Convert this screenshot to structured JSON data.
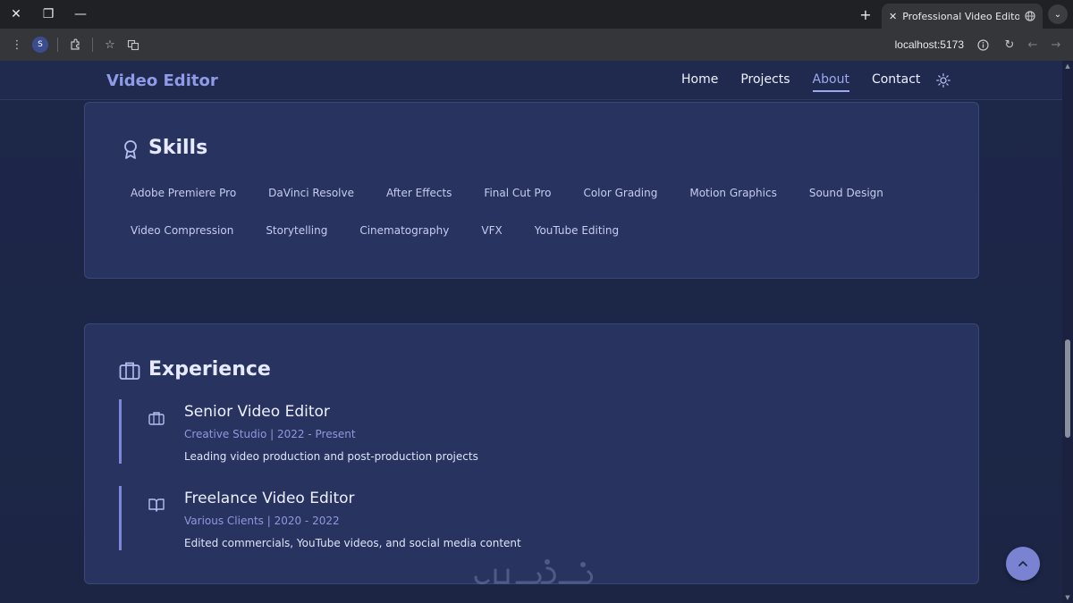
{
  "browser": {
    "tab_title": "Professional Video Editor Portfolio",
    "url": "localhost:5173",
    "profile_initial": "S"
  },
  "site": {
    "brand": "Video Editor",
    "nav": [
      {
        "label": "Home",
        "active": false
      },
      {
        "label": "Projects",
        "active": false
      },
      {
        "label": "About",
        "active": true
      },
      {
        "label": "Contact",
        "active": false
      }
    ]
  },
  "skills": {
    "title": "Skills",
    "row1": [
      "Adobe Premiere Pro",
      "DaVinci Resolve",
      "After Effects",
      "Final Cut Pro",
      "Color Grading",
      "Motion Graphics",
      "Sound Design"
    ],
    "row2": [
      "Video Compression",
      "Storytelling",
      "Cinematography",
      "VFX",
      "YouTube Editing"
    ]
  },
  "experience": {
    "title": "Experience",
    "items": [
      {
        "title": "Senior Video Editor",
        "meta": "Creative Studio | 2022 - Present",
        "description": "Leading video production and post-production projects",
        "icon": "briefcase-icon"
      },
      {
        "title": "Freelance Video Editor",
        "meta": "Various Clients | 2020 - 2022",
        "description": "Edited commercials, YouTube videos, and social media content",
        "icon": "book-icon"
      }
    ]
  },
  "colors": {
    "accent": "#7d87d8",
    "card_bg": "#283360",
    "page_bg": "#1d2749"
  }
}
